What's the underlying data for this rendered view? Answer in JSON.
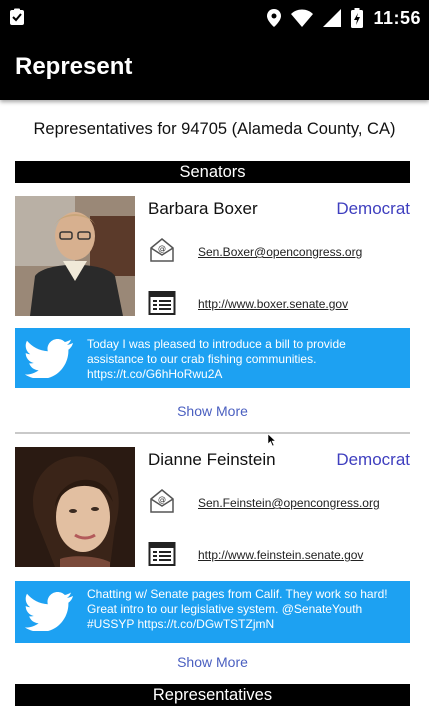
{
  "status_bar": {
    "time": "11:56"
  },
  "app_bar": {
    "title": "Represent"
  },
  "subtitle": "Representatives for 94705 (Alameda County, CA)",
  "sections": {
    "senators": "Senators",
    "representatives": "Representatives"
  },
  "senators": [
    {
      "name": "Barbara Boxer",
      "party": "Democrat",
      "email": "Sen.Boxer@opencongress.org",
      "website": "http://www.boxer.senate.gov",
      "tweet": "Today I was pleased to introduce a bill to provide assistance to our crab fishing communities. https://t.co/G6hHoRwu2A",
      "show_more": "Show More"
    },
    {
      "name": "Dianne Feinstein",
      "party": "Democrat",
      "email": "Sen.Feinstein@opencongress.org",
      "website": "http://www.feinstein.senate.gov",
      "tweet": "Chatting w/ Senate pages from Calif. They work so hard! Great intro to our legislative system. @SenateYouth #USSYP https://t.co/DGwTSTZjmN",
      "show_more": "Show More"
    }
  ],
  "colors": {
    "party": "#3f3fbf",
    "tweet_bg": "#1da1f2",
    "link": "#4a5fc0"
  }
}
